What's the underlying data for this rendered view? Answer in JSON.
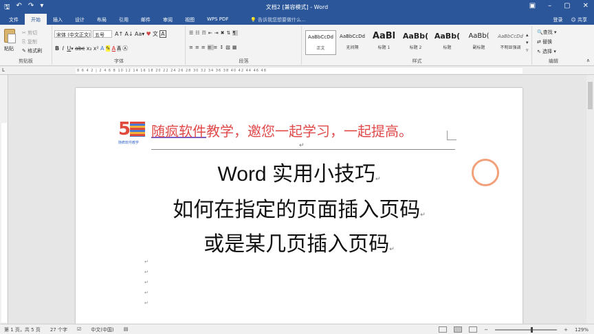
{
  "titlebar": {
    "title": "文档2 [兼容模式] - Word",
    "quick_access": [
      "save-icon",
      "undo-icon",
      "redo-icon",
      "customize-icon"
    ],
    "window_controls": [
      "ribbon-display-icon",
      "minimize-icon",
      "maximize-icon",
      "close-icon"
    ]
  },
  "menubar": {
    "tabs": [
      "文件",
      "开始",
      "插入",
      "设计",
      "布局",
      "引用",
      "邮件",
      "审阅",
      "视图",
      "WPS PDF"
    ],
    "active_tab": "开始",
    "tell_me": "告诉我您想要做什么...",
    "login": "登录",
    "share": "共享"
  },
  "ribbon": {
    "clipboard": {
      "paste": "粘贴",
      "cut": "剪切",
      "copy": "复制",
      "format_painter": "格式刷",
      "label": "剪贴板"
    },
    "font": {
      "name": "宋体 (中文正文)",
      "size": "五号",
      "label": "字体"
    },
    "paragraph": {
      "label": "段落"
    },
    "styles": {
      "label": "样式",
      "items": [
        {
          "sample": "AaBbCcDd",
          "name": "正文"
        },
        {
          "sample": "AaBbCcDd",
          "name": "无间隔"
        },
        {
          "sample": "AaBl",
          "name": "标题 1"
        },
        {
          "sample": "AaBb(",
          "name": "标题 2"
        },
        {
          "sample": "AaBb(",
          "name": "标题"
        },
        {
          "sample": "AaBb(",
          "name": "副标题"
        },
        {
          "sample": "AaBbCcDd",
          "name": "不明显强调"
        }
      ]
    },
    "editing": {
      "find": "查找",
      "replace": "替换",
      "select": "选择",
      "label": "编辑"
    }
  },
  "ruler": {
    "numbers": "8 6 4 2 | 2 4 6 8 10 12 14 16 18 20 22 24 26 28 30 32 34 36 38 40 42 44 46 48"
  },
  "document": {
    "logo_text": "随疯软件教学",
    "header_line": "随疯软件教学，邀您一起学习，一起提高。",
    "header_underlined": "随疯软件",
    "header_rest": "教学，邀您一起学习，一起提高。",
    "title_line1": "Word 实用小技巧",
    "title_line2": "如何在指定的页面插入页码",
    "title_line3": "或是某几页插入页码",
    "para_mark": "↵"
  },
  "status": {
    "page": "第 1 页，共 5 页",
    "words": "27 个字",
    "language": "中文(中国)",
    "zoom": "129%"
  }
}
